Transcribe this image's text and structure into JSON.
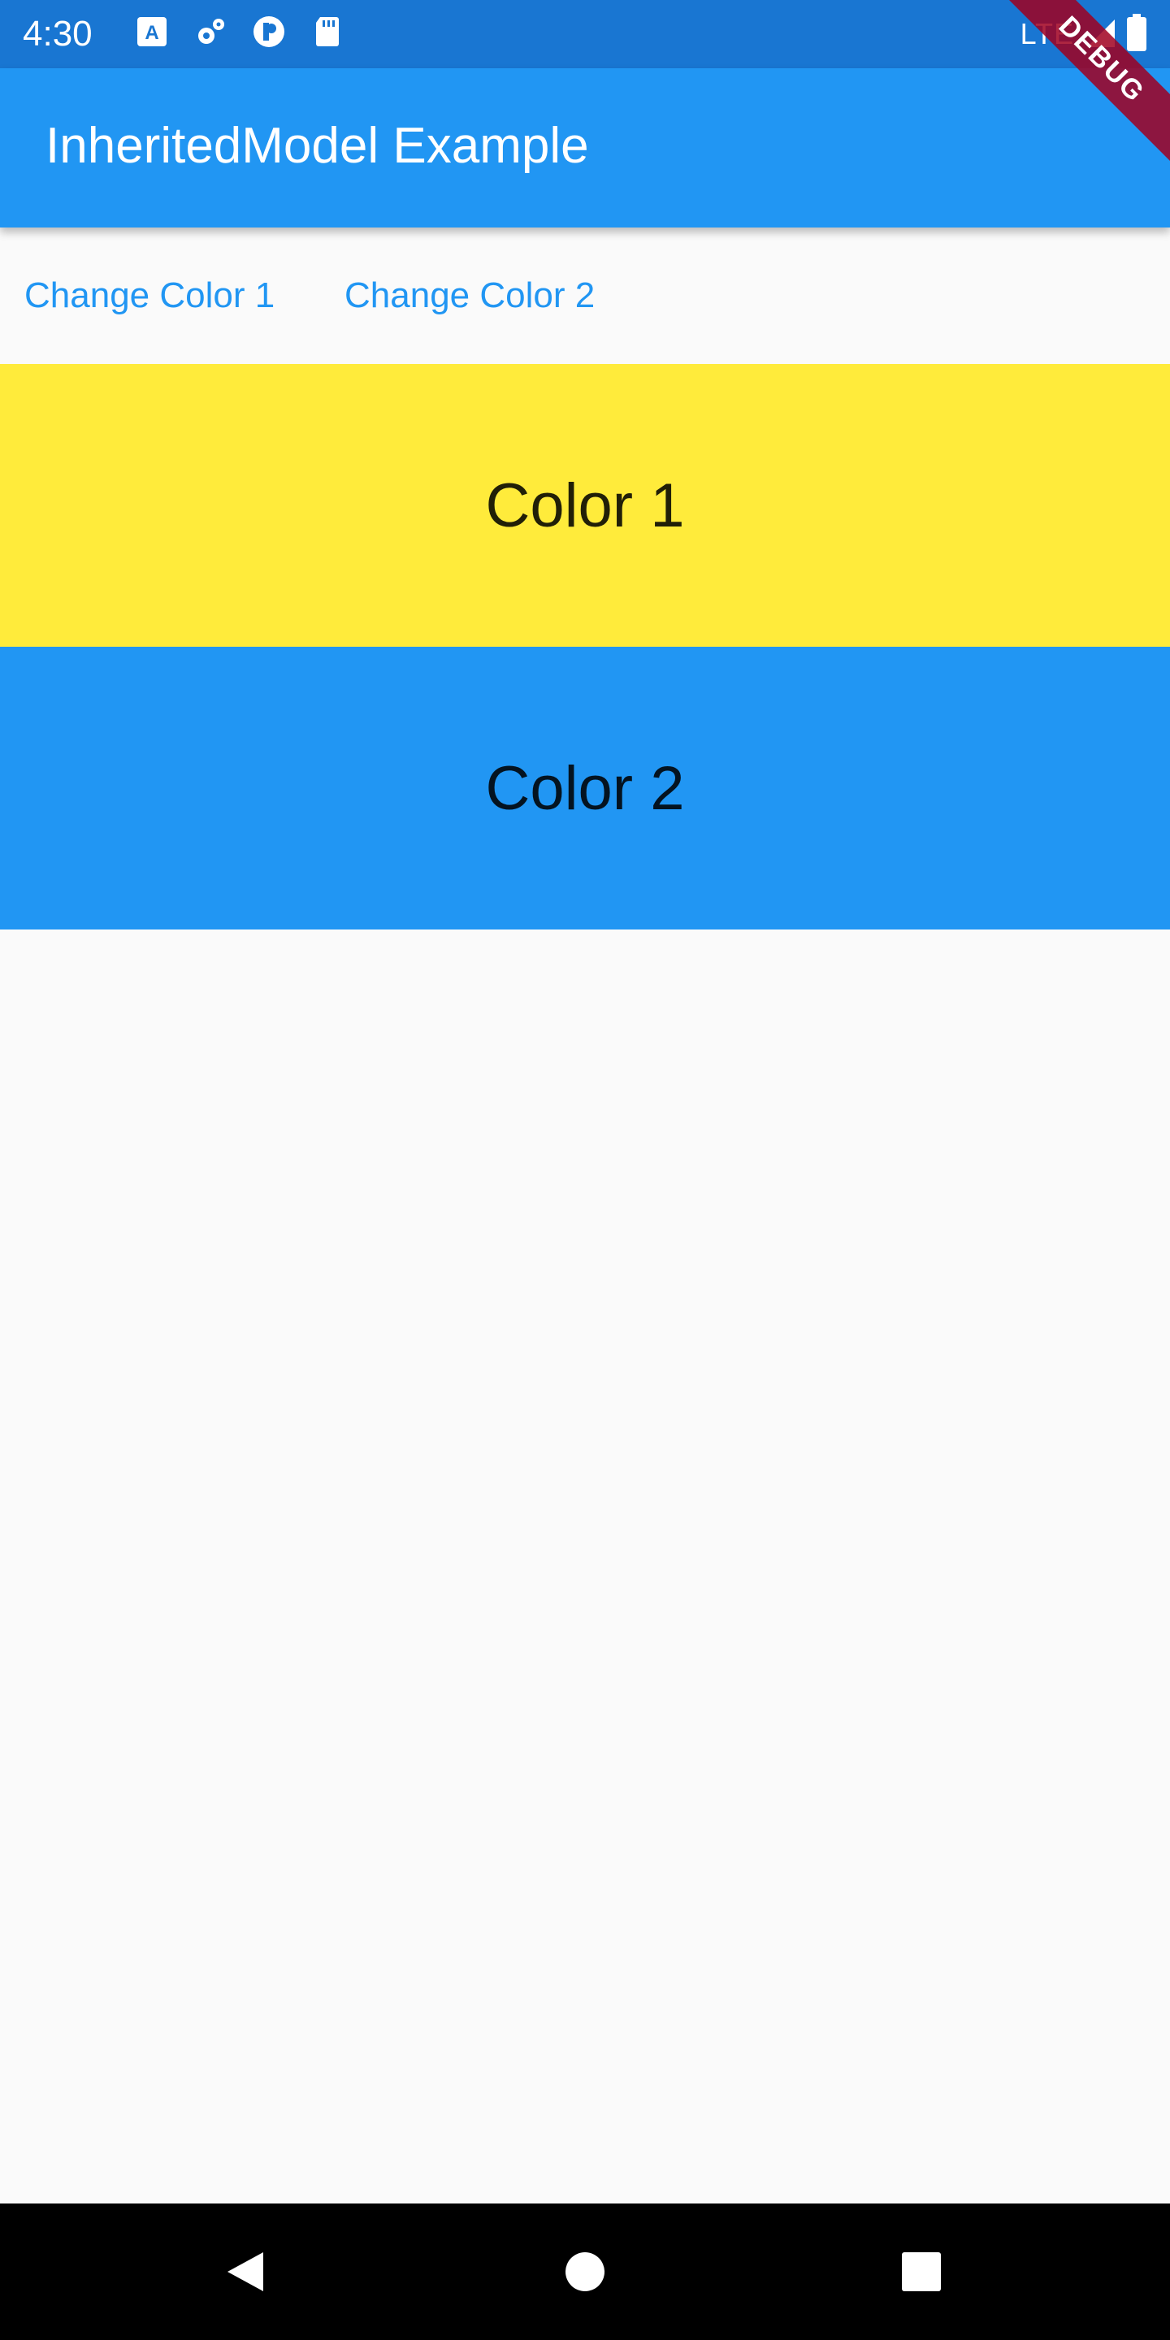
{
  "status_bar": {
    "time": "4:30",
    "network": "LTE",
    "icons": [
      "font-icon",
      "settings-gear-icon",
      "app-badge-icon",
      "sd-card-icon",
      "signal-icon",
      "battery-icon"
    ],
    "background": "#1976d2"
  },
  "app_bar": {
    "title": "InheritedModel Example",
    "background": "#2196f3",
    "debug_banner": "DEBUG"
  },
  "buttons": {
    "change_color_1": "Change Color 1",
    "change_color_2": "Change Color 2",
    "color": "#2196f3"
  },
  "panels": [
    {
      "label": "Color 1",
      "color": "#ffeb3b"
    },
    {
      "label": "Color 2",
      "color": "#2196f3"
    }
  ],
  "navigation_bar": {
    "buttons": [
      "back-icon",
      "home-icon",
      "recents-icon"
    ]
  }
}
